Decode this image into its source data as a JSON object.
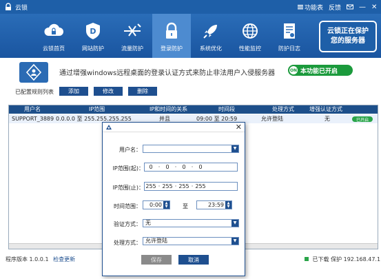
{
  "titlebar": {
    "title": "云锁",
    "menu_label": "功能表",
    "feedback_label": "反馈",
    "minimize": "—",
    "close": "✕"
  },
  "nav": {
    "items": [
      {
        "label": "云锁首页",
        "icon": "cloud-lock-icon"
      },
      {
        "label": "网站防护",
        "icon": "shield-d-icon"
      },
      {
        "label": "流量防护",
        "icon": "traffic-icon"
      },
      {
        "label": "登录防护",
        "icon": "lock-icon"
      },
      {
        "label": "系统优化",
        "icon": "rocket-icon"
      },
      {
        "label": "性能监控",
        "icon": "globe-icon"
      },
      {
        "label": "防护日志",
        "icon": "log-icon"
      }
    ],
    "active_index": 3,
    "promo_line1": "云锁正在保护",
    "promo_line2": "您的服务器"
  },
  "info": {
    "description": "通过增强windows远程桌面的登录认证方式来防止非法用户入侵服务器",
    "feature_status": "本功能已开启",
    "feature_dot": "ON"
  },
  "rules": {
    "label": "已配置规则列表",
    "add": "添加",
    "edit": "修改",
    "delete": "删除"
  },
  "table": {
    "headers": [
      "用户名",
      "IP范围",
      "IP和时间的关系",
      "时间段",
      "处理方式",
      "增强认证方式"
    ],
    "row": {
      "user": "SUPPORT_3889",
      "ip_range": "0.0.0.0 至 255.255.255.255",
      "relation": "并且",
      "time": "09:00 至 20:59",
      "action": "允许登陆",
      "auth": "无",
      "status": "已开启"
    }
  },
  "footer": {
    "version": "程序版本 1.0.0.1",
    "update": "检查更新",
    "status": "已下载 保护 192.168.47.1"
  },
  "dialog": {
    "username_label": "用户名：",
    "username_value": "",
    "ip_start_label": "IP范围(起)：",
    "ip_start": [
      "0",
      "0",
      "0",
      "0"
    ],
    "ip_end_label": "IP范围(止)：",
    "ip_end": [
      "255",
      "255",
      "255",
      "255"
    ],
    "time_label": "时间范围：",
    "time_start": "0:00",
    "time_to": "至",
    "time_end": "23:59",
    "auth_label": "验证方式：",
    "auth_value": "无",
    "action_label": "处理方式：",
    "action_value": "允许登陆",
    "save": "保存",
    "cancel": "取消",
    "close": "✕"
  },
  "colors": {
    "brand_blue": "#1e5fa8",
    "button_dark": "#1e4f8f",
    "green": "#1b9a3c"
  }
}
